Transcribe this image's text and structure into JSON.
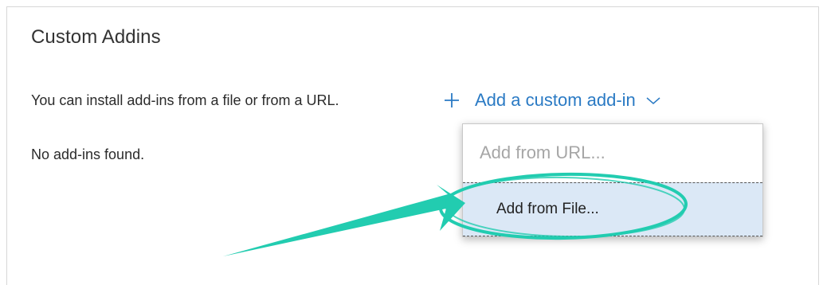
{
  "panel": {
    "title": "Custom Addins",
    "description": "You can install add-ins from a file or from a URL.",
    "add_button_label": "Add a custom add-in",
    "empty_message": "No add-ins found."
  },
  "dropdown": {
    "items": [
      {
        "label": "Add from URL..."
      },
      {
        "label": "Add from File..."
      }
    ],
    "highlighted_index": 1
  },
  "colors": {
    "link": "#2a7ac4",
    "annotation": "#22ccb0",
    "highlight": "#dbe8f6"
  },
  "icons": {
    "add": "plus-icon",
    "expand": "chevron-down-icon",
    "annotation": "arrow-icon"
  }
}
